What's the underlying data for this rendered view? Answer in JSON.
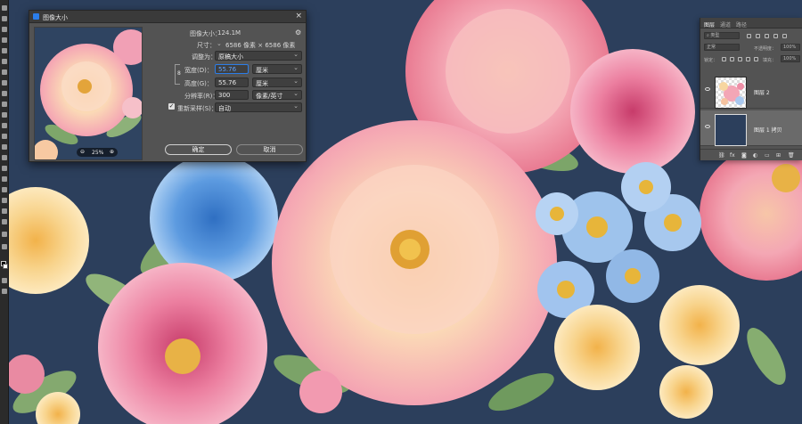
{
  "dialog": {
    "title": "图像大小",
    "image_size_label": "图像大小：",
    "image_size_value": "124.1M",
    "dimensions_label": "尺寸：",
    "dimensions_value": "6586 像素 × 6586 像素",
    "fit_label": "调整为：",
    "fit_value": "原稿大小",
    "width_label": "宽度(D)：",
    "width_value": "55.76",
    "width_unit": "厘米",
    "height_label": "高度(G)：",
    "height_value": "55.76",
    "height_unit": "厘米",
    "resolution_label": "分辨率(R)：",
    "resolution_value": "300",
    "resolution_unit": "像素/英寸",
    "resample_label": "重新采样(S)：",
    "resample_checked": true,
    "resample_value": "自动",
    "zoom_value": "25%",
    "ok_label": "确定",
    "cancel_label": "取消"
  },
  "layers_panel": {
    "tabs": [
      "图层",
      "通道",
      "路径"
    ],
    "search_placeholder": "类型",
    "blend_mode": "正常",
    "opacity_label": "不透明度：",
    "opacity_value": "100%",
    "lock_label": "锁定：",
    "fill_label": "填充：",
    "fill_value": "100%",
    "layers": [
      {
        "name": "图层 2",
        "visible": true,
        "selected": false
      },
      {
        "name": "图层 1 拷贝",
        "visible": true,
        "selected": true
      }
    ]
  },
  "colors": {
    "canvas_background": "#2c3f5c",
    "panel": "#535353",
    "accent": "#2b7de9"
  }
}
